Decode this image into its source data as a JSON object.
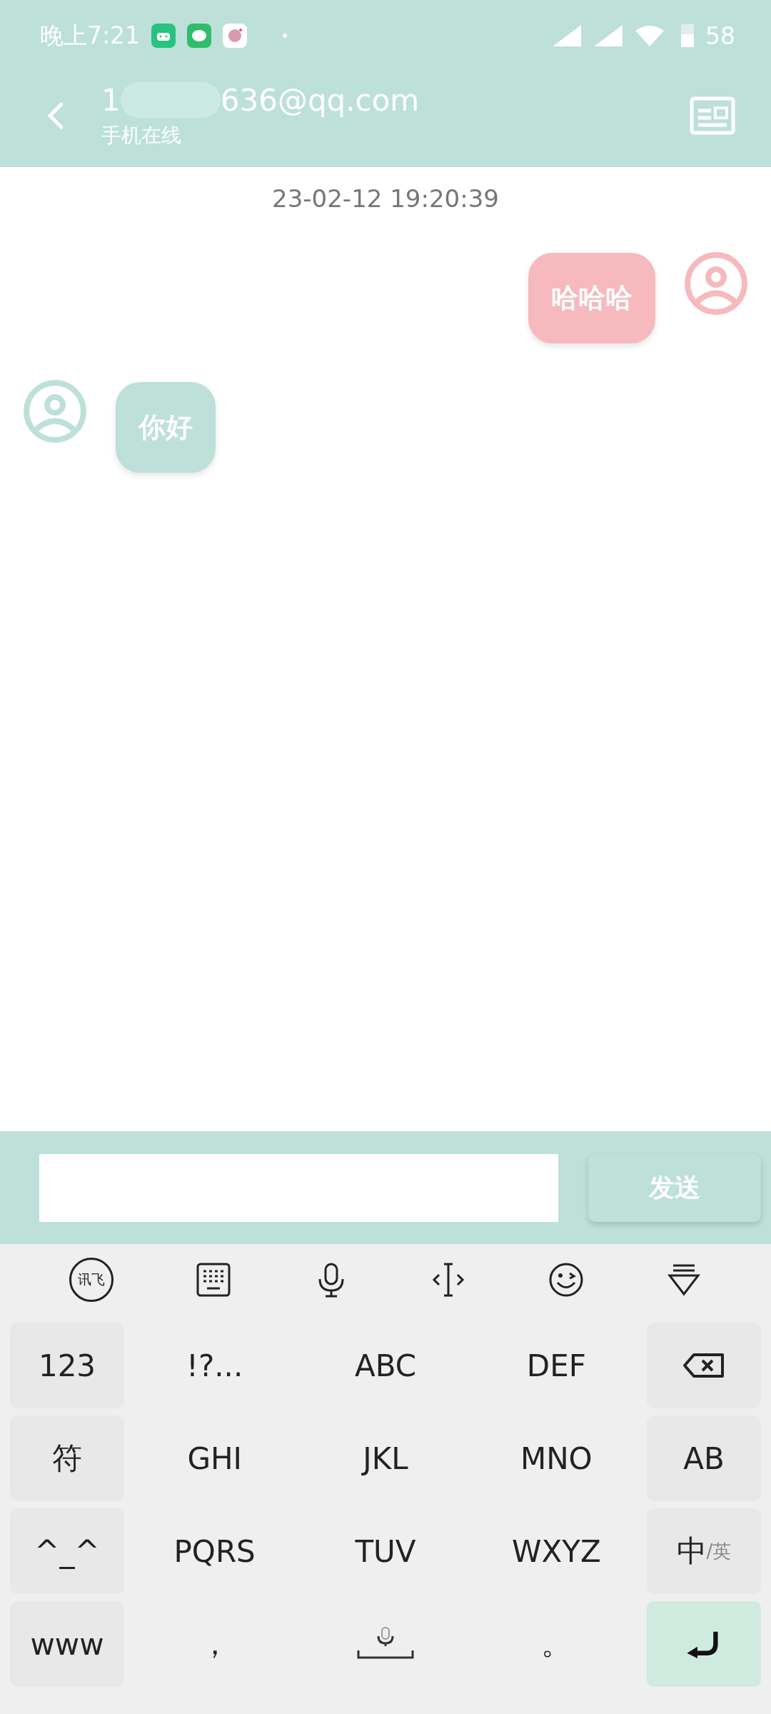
{
  "status_bar": {
    "time": "晚上7:21",
    "battery": "58"
  },
  "header": {
    "title_start": "1",
    "title_end": "636@qq.com",
    "subtitle": "手机在线"
  },
  "timestamp": "23-02-12 19:20:39",
  "messages": [
    {
      "kind": "sent",
      "text": "哈哈哈"
    },
    {
      "kind": "received",
      "text": "你好"
    }
  ],
  "send_button": "发送",
  "toolbar": [
    {
      "kind": "logo",
      "label": "讯飞"
    },
    {
      "kind": "keyboard"
    },
    {
      "kind": "mic"
    },
    {
      "kind": "cursor"
    },
    {
      "kind": "emoji"
    },
    {
      "kind": "hide"
    }
  ],
  "keyboard": [
    [
      {
        "kind": "side",
        "label": "123"
      },
      {
        "kind": "key",
        "label": "!?..."
      },
      {
        "kind": "key",
        "label": "ABC"
      },
      {
        "kind": "key",
        "label": "DEF"
      },
      {
        "kind": "backspace"
      }
    ],
    [
      {
        "kind": "side",
        "label": "符"
      },
      {
        "kind": "key",
        "label": "GHI"
      },
      {
        "kind": "key",
        "label": "JKL"
      },
      {
        "kind": "key",
        "label": "MNO"
      },
      {
        "kind": "side",
        "label": "AB"
      }
    ],
    [
      {
        "kind": "side",
        "label": "^_^"
      },
      {
        "kind": "key",
        "label": "PQRS"
      },
      {
        "kind": "key",
        "label": "TUV"
      },
      {
        "kind": "key",
        "label": "WXYZ"
      },
      {
        "kind": "lang",
        "label": "中",
        "sub": "/英"
      }
    ],
    [
      {
        "kind": "side",
        "label": "www"
      },
      {
        "kind": "key",
        "label": "，"
      },
      {
        "kind": "space"
      },
      {
        "kind": "key",
        "label": "。"
      },
      {
        "kind": "enter"
      }
    ]
  ]
}
